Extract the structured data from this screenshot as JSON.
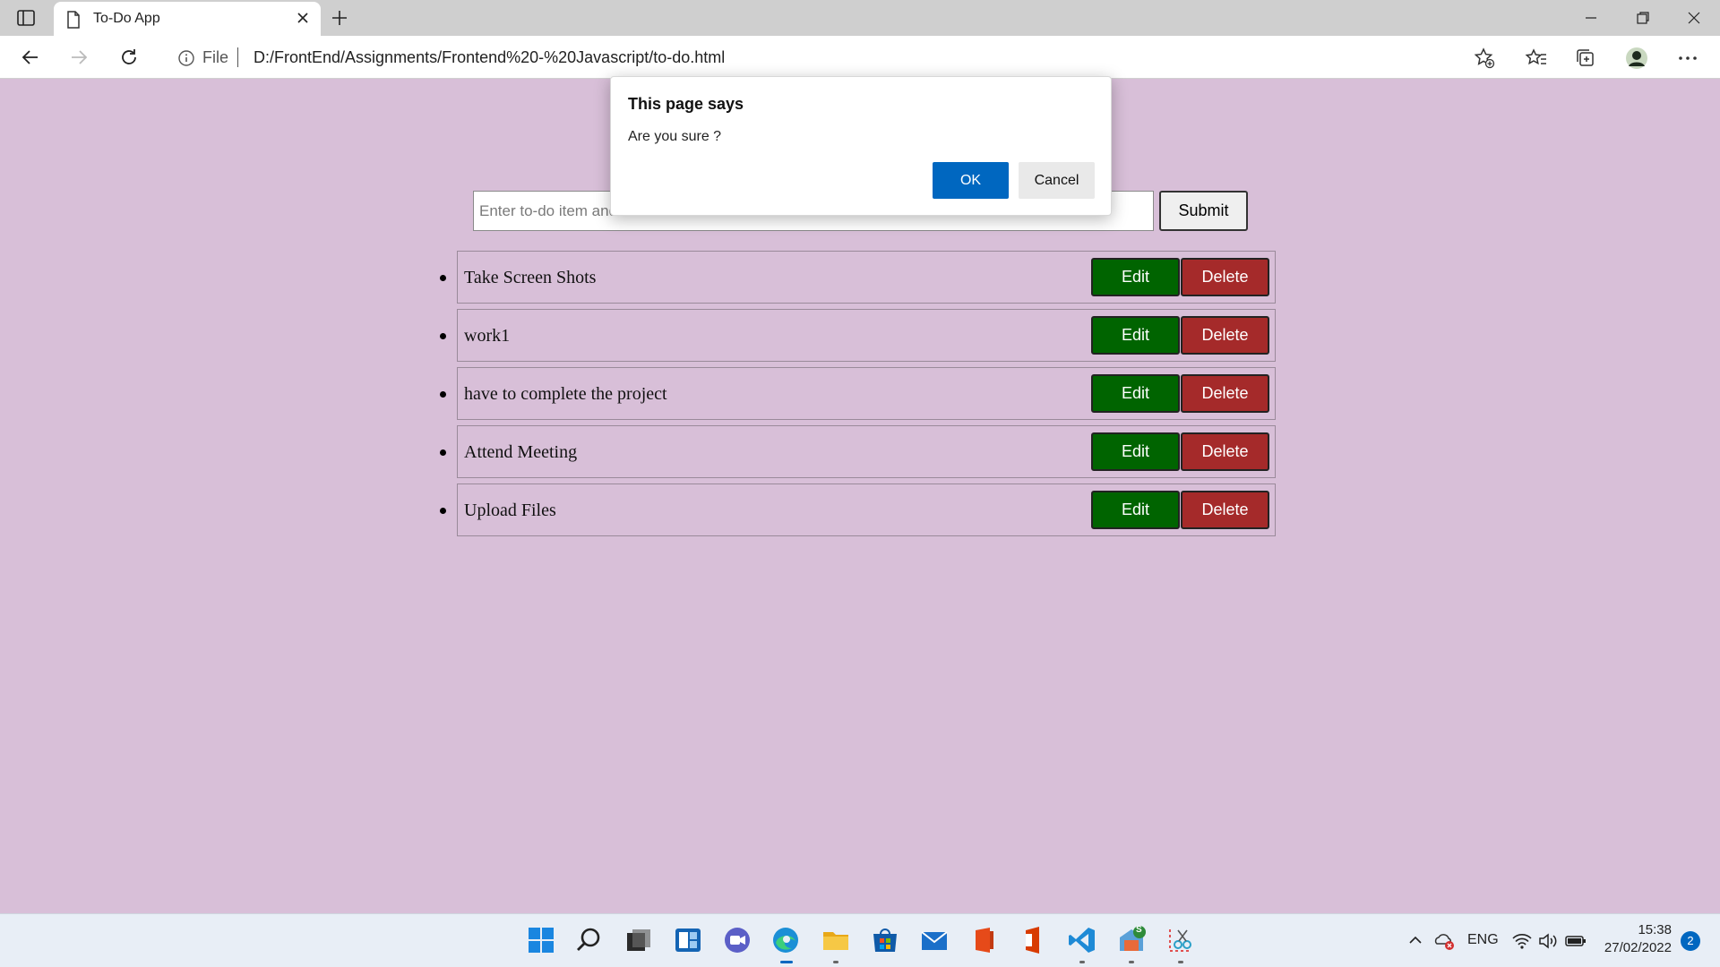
{
  "browser": {
    "tab_title": "To-Do App",
    "address_prefix": "File",
    "url": "D:/FrontEnd/Assignments/Frontend%20-%20Javascript/to-do.html"
  },
  "form": {
    "input_placeholder": "Enter to-do item and",
    "submit_label": "Submit"
  },
  "todos": [
    {
      "text": "Take Screen Shots",
      "edit_label": "Edit",
      "delete_label": "Delete"
    },
    {
      "text": "work1",
      "edit_label": "Edit",
      "delete_label": "Delete"
    },
    {
      "text": "have to complete the project",
      "edit_label": "Edit",
      "delete_label": "Delete"
    },
    {
      "text": "Attend Meeting",
      "edit_label": "Edit",
      "delete_label": "Delete"
    },
    {
      "text": "Upload Files",
      "edit_label": "Edit",
      "delete_label": "Delete"
    }
  ],
  "dialog": {
    "title": "This page says",
    "message": "Are you sure ?",
    "ok_label": "OK",
    "cancel_label": "Cancel"
  },
  "taskbar": {
    "apps": [
      "start-icon",
      "search-icon",
      "task-view-icon",
      "widgets-icon",
      "teams-chat-icon",
      "edge-icon",
      "file-explorer-icon",
      "store-icon",
      "mail-icon",
      "office-icon",
      "office-app-icon",
      "vscode-icon",
      "app-with-badge-icon",
      "snipping-tool-icon"
    ],
    "badge_text": "S",
    "language": "ENG",
    "time": "15:38",
    "date": "27/02/2022",
    "notification_count": "2"
  },
  "colors": {
    "page_bg": "#d8bfd8",
    "edit_bg": "#006400",
    "delete_bg": "#a52a2a",
    "ok_bg": "#0067c0"
  }
}
